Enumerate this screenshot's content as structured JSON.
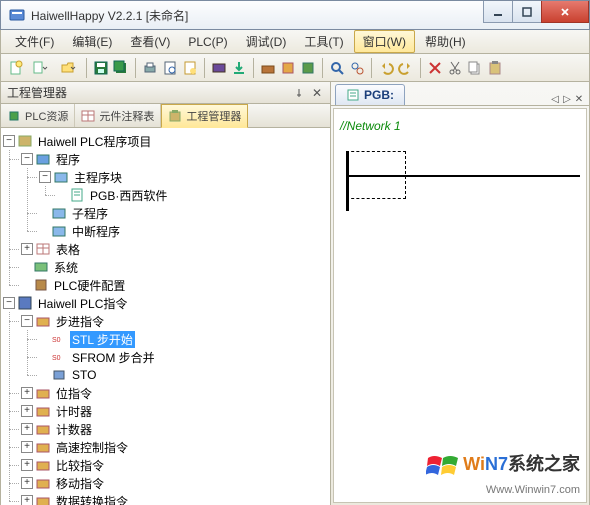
{
  "window": {
    "title": "HaiwellHappy V2.2.1 [未命名]"
  },
  "menu": {
    "file": "文件(F)",
    "edit": "编辑(E)",
    "view": "查看(V)",
    "plc": "PLC(P)",
    "debug": "调试(D)",
    "tool": "工具(T)",
    "window": "窗口(W)",
    "help": "帮助(H)"
  },
  "panel": {
    "title": "工程管理器",
    "tabs": {
      "plcRes": "PLC资源",
      "comments": "元件注释表",
      "project": "工程管理器"
    }
  },
  "tree": {
    "project": "Haiwell PLC程序项目",
    "programs": "程序",
    "mainBlock": "主程序块",
    "pgb": "PGB·西西软件",
    "subProg": "子程序",
    "intProg": "中断程序",
    "tables": "表格",
    "system": "系统",
    "hwConfig": "PLC硬件配置",
    "instrRoot": "Haiwell PLC指令",
    "stepInstr": "步进指令",
    "stl": "STL 步开始",
    "sfrom": "SFROM 步合并",
    "sto": "STO",
    "bit": "位指令",
    "timer": "计时器",
    "counter": "计数器",
    "hispeed": "高速控制指令",
    "compare": "比较指令",
    "move": "移动指令",
    "convert": "数据转换指令"
  },
  "editor": {
    "tab": "PGB:",
    "network": "//Network 1"
  },
  "watermark": {
    "brand1": "Wi",
    "brand2": "N7",
    "brand3": "系统之家",
    "url": "Www.Winwin7.com"
  }
}
